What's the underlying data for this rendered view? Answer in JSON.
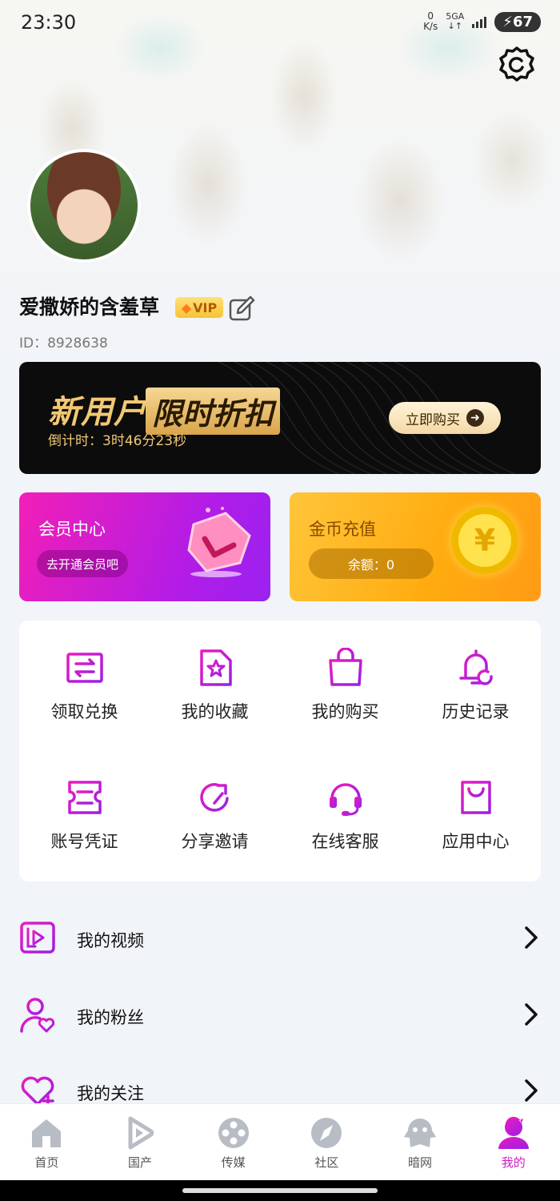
{
  "status_bar": {
    "time": "23:30",
    "net_speed_value": "0",
    "net_speed_unit": "K/s",
    "network": "5GA",
    "battery": "67"
  },
  "profile": {
    "username": "爱撒娇的含羞草",
    "vip_badge": "VIP",
    "user_id": "ID：8928638"
  },
  "promo_banner": {
    "title_part1": "新用户",
    "title_part2": "限时折扣",
    "countdown": "倒计时：3时46分23秒",
    "button_label": "立即购买"
  },
  "cards": {
    "membership": {
      "title": "会员中心",
      "action": "去开通会员吧"
    },
    "coins": {
      "title": "金币充值",
      "balance": "余额：0",
      "coin_symbol": "¥"
    }
  },
  "grid": [
    {
      "label": "领取兑换",
      "icon": "exchange-icon"
    },
    {
      "label": "我的收藏",
      "icon": "favorite-star-icon"
    },
    {
      "label": "我的购买",
      "icon": "shopping-bag-icon"
    },
    {
      "label": "历史记录",
      "icon": "history-bell-icon"
    },
    {
      "label": "账号凭证",
      "icon": "ticket-icon"
    },
    {
      "label": "分享邀请",
      "icon": "share-icon"
    },
    {
      "label": "在线客服",
      "icon": "headset-icon"
    },
    {
      "label": "应用中心",
      "icon": "app-bag-icon"
    }
  ],
  "list": [
    {
      "label": "我的视频",
      "icon": "video-icon"
    },
    {
      "label": "我的粉丝",
      "icon": "fans-icon"
    },
    {
      "label": "我的关注",
      "icon": "follow-heart-icon"
    }
  ],
  "tabs": [
    {
      "label": "首页",
      "icon": "home-icon"
    },
    {
      "label": "国产",
      "icon": "play-icon"
    },
    {
      "label": "传媒",
      "icon": "film-reel-icon"
    },
    {
      "label": "社区",
      "icon": "compass-icon"
    },
    {
      "label": "暗网",
      "icon": "ghost-icon"
    },
    {
      "label": "我的",
      "icon": "profile-icon",
      "active": true
    }
  ],
  "colors": {
    "accent": "#d21cc7",
    "accent_purple": "#a51ee0",
    "gold": "#f3c873",
    "coin_orange": "#ffab0f"
  }
}
